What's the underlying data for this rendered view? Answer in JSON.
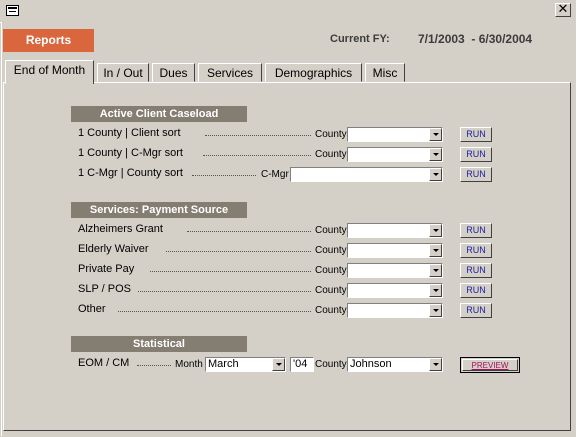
{
  "window": {
    "close_glyph": "✕"
  },
  "header": {
    "reports_label": "Reports",
    "fy_label": "Current FY:",
    "fy_range": "7/1/2003  - 6/30/2004"
  },
  "tabs": [
    {
      "label": "End of Month",
      "active": true
    },
    {
      "label": "In / Out"
    },
    {
      "label": "Dues"
    },
    {
      "label": "Services"
    },
    {
      "label": "Demographics"
    },
    {
      "label": "Misc"
    }
  ],
  "caseload": {
    "title": "Active Client Caseload",
    "rows": [
      {
        "label": "1 County | Client sort",
        "field_label": "County",
        "value": "",
        "button": "RUN"
      },
      {
        "label": "1 County | C-Mgr sort",
        "field_label": "County",
        "value": "",
        "button": "RUN"
      },
      {
        "label": "1 C-Mgr | County sort",
        "field_label": "C-Mgr",
        "value": "",
        "button": "RUN"
      }
    ]
  },
  "services": {
    "title": "Services:  Payment Source",
    "rows": [
      {
        "label": "Alzheimers Grant",
        "field_label": "County",
        "value": "",
        "button": "RUN"
      },
      {
        "label": "Elderly Waiver",
        "field_label": "County",
        "value": "",
        "button": "RUN"
      },
      {
        "label": "Private Pay",
        "field_label": "County",
        "value": "",
        "button": "RUN"
      },
      {
        "label": "SLP / POS",
        "field_label": "County",
        "value": "",
        "button": "RUN"
      },
      {
        "label": "Other",
        "field_label": "County",
        "value": "",
        "button": "RUN"
      }
    ]
  },
  "statistical": {
    "title": "Statistical",
    "row_label": "EOM / CM",
    "month_label": "Month",
    "month_value": "March",
    "year_value": "'04",
    "county_label": "County",
    "county_value": "Johnson",
    "button": "PREVIEW"
  }
}
